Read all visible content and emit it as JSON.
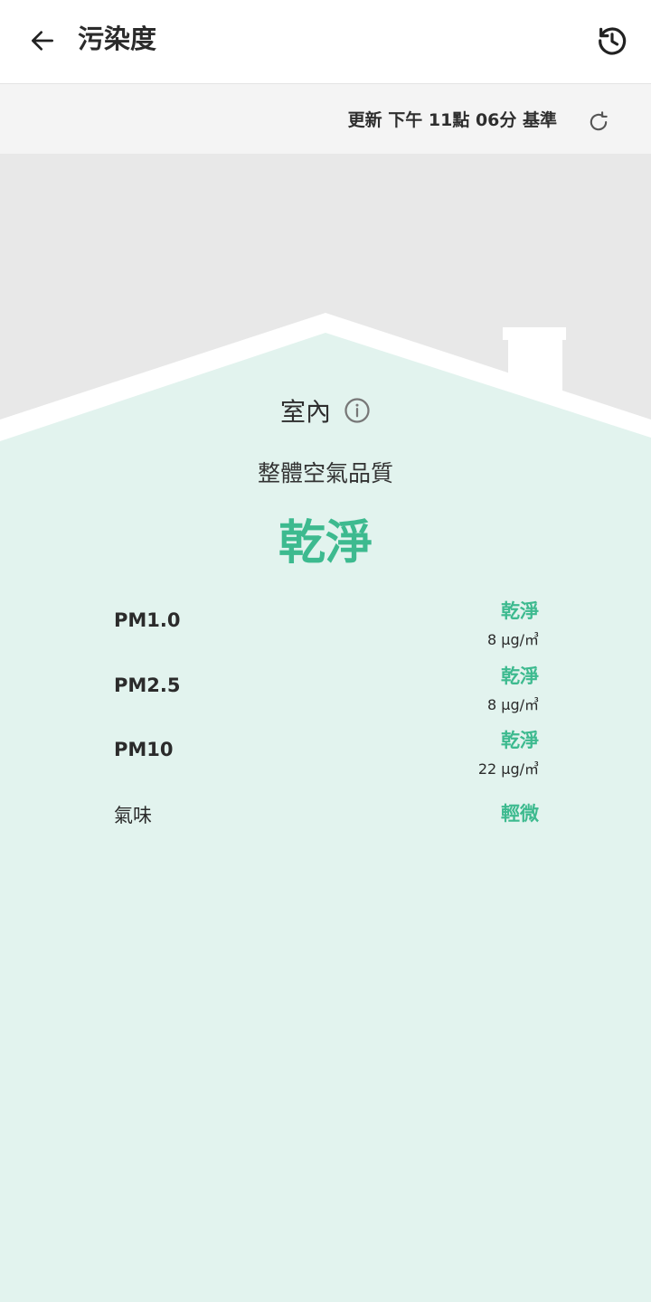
{
  "header": {
    "title": "污染度"
  },
  "update": {
    "text": "更新 下午 11點 06分 基準"
  },
  "indoor": {
    "label": "室內"
  },
  "overall": {
    "label": "整體空氣品質",
    "value": "乾淨"
  },
  "metrics": [
    {
      "name": "PM1.0",
      "level": "乾淨",
      "value": "8 μg/㎥"
    },
    {
      "name": "PM2.5",
      "level": "乾淨",
      "value": "8 μg/㎥"
    },
    {
      "name": "PM10",
      "level": "乾淨",
      "value": "22 μg/㎥"
    },
    {
      "name": "氣味",
      "level": "輕微",
      "value": ""
    }
  ],
  "colors": {
    "accent": "#3dba8f",
    "background": "#e2f3ee",
    "sky": "#e8e8e8"
  },
  "icons": {
    "back": "arrow-left-icon",
    "history": "history-clock-icon",
    "refresh": "refresh-icon",
    "info": "info-icon"
  }
}
